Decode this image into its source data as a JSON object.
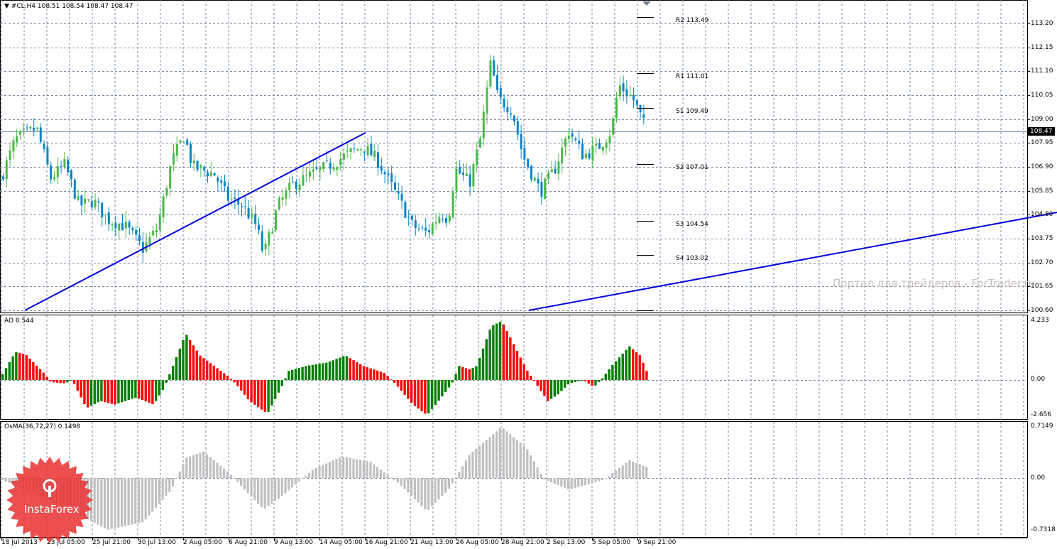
{
  "header": {
    "symbol": "#CL,H4",
    "ohlc": "108.51 108.54 108.47 108.47"
  },
  "colors": {
    "bull": "#4cb848",
    "bear": "#0a84c8",
    "trend": "#0000e0",
    "grid": "#7a8aa0",
    "ao_up": "#007f00",
    "ao_down": "#ff0000",
    "osma": "#c0c0c0"
  },
  "price_axis": {
    "ticks": [
      "113.20",
      "112.15",
      "111.10",
      "110.05",
      "109.00",
      "107.95",
      "106.90",
      "105.85",
      "104.80",
      "103.75",
      "102.70",
      "101.65",
      "100.60"
    ],
    "current": "108.47"
  },
  "pivots": [
    {
      "label": "R2 113.49"
    },
    {
      "label": "R1 111.01"
    },
    {
      "label": "S1 109.49"
    },
    {
      "label": "S2 107.01"
    },
    {
      "label": "S3 104.54"
    },
    {
      "label": "S4 103.02"
    }
  ],
  "watermark": "Портал для трейдеров - ForTrader.ru",
  "logo": "InstaForex",
  "ao": {
    "title": "AO 0.544",
    "max": "4.233",
    "zero": "0.00",
    "min": "-2.656"
  },
  "osma": {
    "title": "OsMA(36,72,27) 0.1498",
    "max": "0.7149",
    "zero": "0.00",
    "min": "-0.7318"
  },
  "time_axis": [
    "18 Jul 2013",
    "23 Jul 05:00",
    "25 Jul 21:00",
    "30 Jul 13:00",
    "2 Aug 05:00",
    "6 Aug 21:00",
    "9 Aug 13:00",
    "14 Aug 05:00",
    "16 Aug 21:00",
    "21 Aug 13:00",
    "26 Aug 05:00",
    "28 Aug 21:00",
    "2 Sep 13:00",
    "5 Sep 05:00",
    "9 Sep 21:00"
  ],
  "chart_data": {
    "type": "candlestick",
    "price_path": [
      [
        0,
        106.4
      ],
      [
        20,
        108.1
      ],
      [
        50,
        108.6
      ],
      [
        70,
        106.4
      ],
      [
        90,
        107.0
      ],
      [
        110,
        105.2
      ],
      [
        130,
        105.4
      ],
      [
        150,
        104.6
      ],
      [
        175,
        104.3
      ],
      [
        200,
        103.3
      ],
      [
        220,
        104.2
      ],
      [
        240,
        107.1
      ],
      [
        258,
        108.3
      ],
      [
        270,
        106.9
      ],
      [
        300,
        106.6
      ],
      [
        320,
        105.5
      ],
      [
        340,
        105.2
      ],
      [
        360,
        104.3
      ],
      [
        370,
        103.0
      ],
      [
        390,
        105.2
      ],
      [
        410,
        106.1
      ],
      [
        440,
        106.6
      ],
      [
        470,
        107.1
      ],
      [
        490,
        107.5
      ],
      [
        510,
        107.8
      ],
      [
        530,
        107.2
      ],
      [
        560,
        105.5
      ],
      [
        580,
        104.3
      ],
      [
        600,
        104.0
      ],
      [
        620,
        104.9
      ],
      [
        630,
        104.6
      ],
      [
        640,
        106.8
      ],
      [
        660,
        106.2
      ],
      [
        675,
        108.1
      ],
      [
        690,
        111.5
      ],
      [
        700,
        109.9
      ],
      [
        720,
        109.4
      ],
      [
        735,
        107.4
      ],
      [
        760,
        105.8
      ],
      [
        780,
        106.8
      ],
      [
        800,
        108.5
      ],
      [
        820,
        107.4
      ],
      [
        840,
        107.7
      ],
      [
        860,
        108.5
      ],
      [
        870,
        110.5
      ],
      [
        890,
        109.9
      ],
      [
        910,
        108.47
      ]
    ],
    "ao_path": [
      [
        0,
        0.25
      ],
      [
        20,
        2.0
      ],
      [
        35,
        1.8
      ],
      [
        60,
        0.5
      ],
      [
        70,
        -0.15
      ],
      [
        90,
        -0.25
      ],
      [
        100,
        0
      ],
      [
        120,
        -2.0
      ],
      [
        140,
        -1.5
      ],
      [
        160,
        -1.75
      ],
      [
        190,
        -1.25
      ],
      [
        215,
        -1.75
      ],
      [
        230,
        -0.5
      ],
      [
        240,
        0.75
      ],
      [
        260,
        3.3
      ],
      [
        280,
        1.75
      ],
      [
        300,
        1.0
      ],
      [
        320,
        0.25
      ],
      [
        330,
        -0.25
      ],
      [
        350,
        -1.5
      ],
      [
        375,
        -2.4
      ],
      [
        395,
        -0.5
      ],
      [
        405,
        0.65
      ],
      [
        430,
        1.0
      ],
      [
        460,
        1.25
      ],
      [
        485,
        1.75
      ],
      [
        510,
        1.0
      ],
      [
        540,
        0.5
      ],
      [
        555,
        -0.25
      ],
      [
        580,
        -1.75
      ],
      [
        600,
        -2.5
      ],
      [
        620,
        -1.25
      ],
      [
        635,
        -0.25
      ],
      [
        645,
        1.0
      ],
      [
        660,
        0.75
      ],
      [
        670,
        1.0
      ],
      [
        690,
        3.8
      ],
      [
        705,
        4.2
      ],
      [
        720,
        2.75
      ],
      [
        740,
        0.75
      ],
      [
        750,
        0
      ],
      [
        770,
        -1.5
      ],
      [
        785,
        -1.0
      ],
      [
        800,
        -0.25
      ],
      [
        820,
        0
      ],
      [
        835,
        -0.5
      ],
      [
        845,
        0
      ],
      [
        860,
        1.0
      ],
      [
        885,
        2.4
      ],
      [
        900,
        1.75
      ],
      [
        910,
        0.544
      ]
    ],
    "osma_path": [
      [
        0,
        -0.02
      ],
      [
        100,
        -0.45
      ],
      [
        150,
        -0.7
      ],
      [
        200,
        -0.6
      ],
      [
        240,
        -0.16
      ],
      [
        260,
        0.27
      ],
      [
        285,
        0.36
      ],
      [
        320,
        0.08
      ],
      [
        370,
        -0.43
      ],
      [
        400,
        -0.21
      ],
      [
        440,
        0.12
      ],
      [
        480,
        0.29
      ],
      [
        520,
        0.22
      ],
      [
        560,
        -0.07
      ],
      [
        600,
        -0.45
      ],
      [
        630,
        -0.16
      ],
      [
        660,
        0.32
      ],
      [
        705,
        0.69
      ],
      [
        740,
        0.41
      ],
      [
        765,
        -0.02
      ],
      [
        800,
        -0.16
      ],
      [
        850,
        -0.02
      ],
      [
        885,
        0.24
      ],
      [
        910,
        0.1498
      ]
    ],
    "trendlines": [
      [
        [
          35,
          100.6
        ],
        [
          515,
          108.4
        ]
      ],
      [
        [
          745,
          100.6
        ],
        [
          1489,
          104.9
        ]
      ]
    ],
    "pivot_levels": [
      113.49,
      111.01,
      109.49,
      107.01,
      104.54,
      103.02,
      100.6
    ],
    "price_range": [
      100.6,
      113.2
    ]
  }
}
